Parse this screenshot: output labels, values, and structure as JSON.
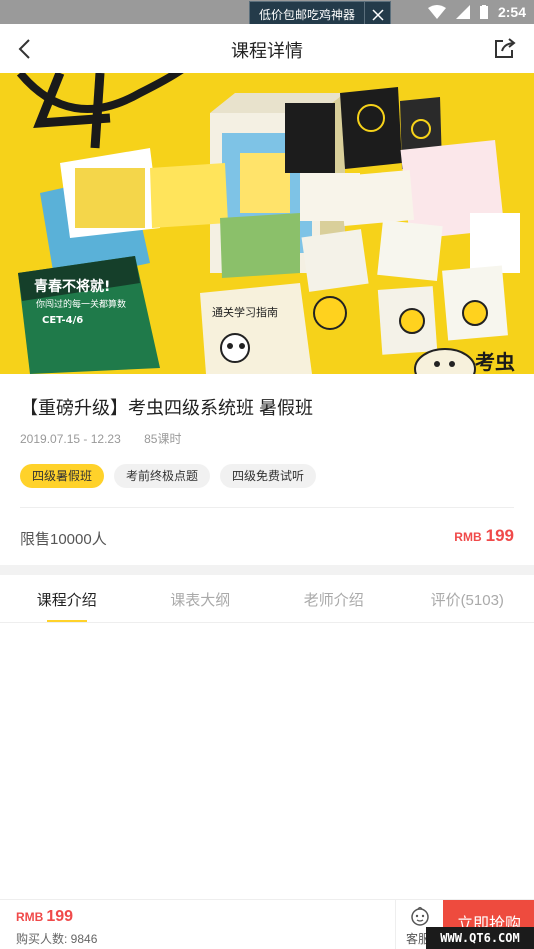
{
  "status_bar": {
    "banner_text": "低价包邮吃鸡神器",
    "time": "2:54"
  },
  "nav": {
    "title": "课程详情"
  },
  "hero": {
    "book_texts": [
      "青春不将就!",
      "你闯过的每一关都算数",
      "CET-4/6",
      "通关学习指南",
      "考虫"
    ]
  },
  "course": {
    "title": "【重磅升级】考虫四级系统班 暑假班",
    "date_range": "2019.07.15 - 12.23",
    "lessons": "85课时",
    "tags": [
      "四级暑假班",
      "考前终极点题",
      "四级免费试听"
    ],
    "limit": "限售10000人",
    "price_currency": "RMB",
    "price": "199"
  },
  "tabs": [
    "课程介绍",
    "课表大纲",
    "老师介绍",
    "评价(5103)"
  ],
  "bottom_bar": {
    "price_currency": "RMB",
    "price": "199",
    "buyers": "购买人数: 9846",
    "service_label": "客服",
    "buy_label": "立即抢购"
  },
  "watermark": "WWW.QT6.COM",
  "colors": {
    "accent_yellow": "#ffd22a",
    "price_red": "#f04a4a",
    "buy_button": "#ee4b3e"
  }
}
